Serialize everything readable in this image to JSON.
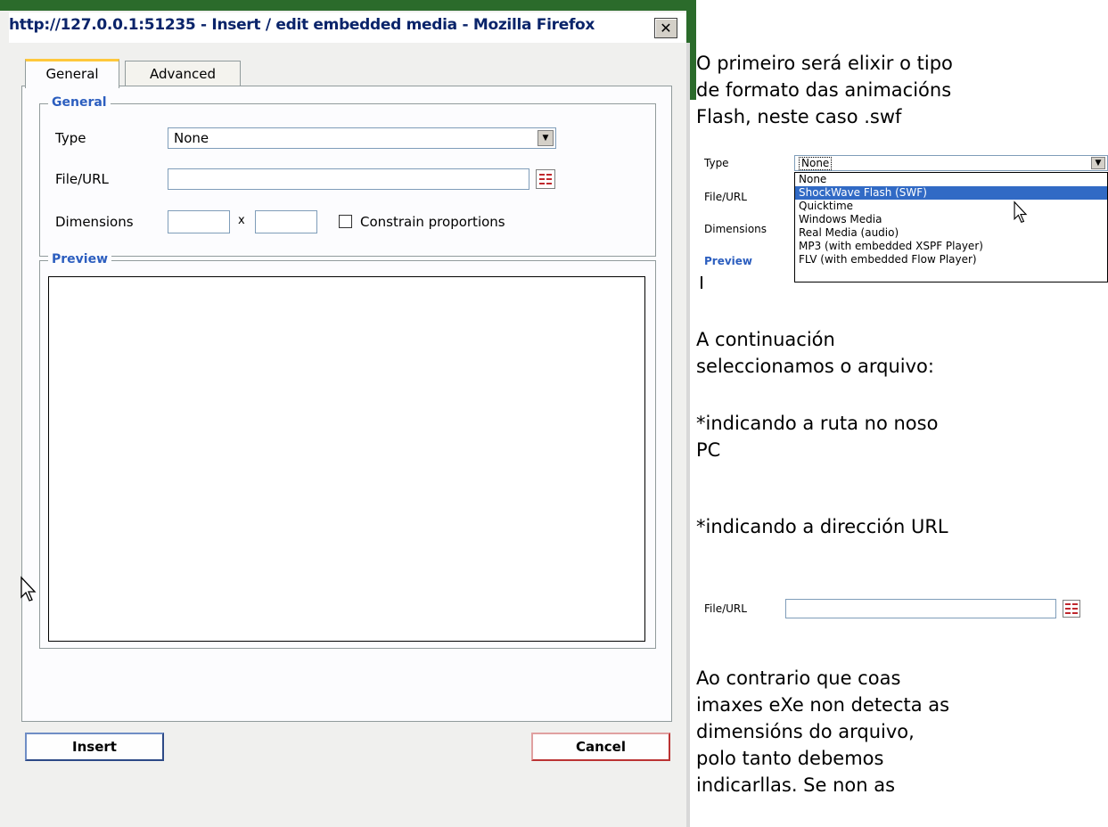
{
  "dialog": {
    "title": "http://127.0.0.1:51235 - Insert / edit embedded media - Mozilla Firefox",
    "close_label": "✕",
    "tabs": [
      {
        "label": "General",
        "active": true
      },
      {
        "label": "Advanced",
        "active": false
      }
    ],
    "general_legend": "General",
    "type_label": "Type",
    "type_value": "None",
    "file_label": "File/URL",
    "file_value": "",
    "dimensions_label": "Dimensions",
    "dimensions_sep": "x",
    "width_value": "",
    "height_value": "",
    "constrain_label": "Constrain proportions",
    "preview_legend": "Preview",
    "insert_label": "Insert",
    "cancel_label": "Cancel"
  },
  "instructions": {
    "p1": [
      "O primeiro será elixir o tipo",
      "de formato das animacións",
      "Flash, neste caso .swf"
    ],
    "p2": [
      "A continuación",
      "seleccionamos o arquivo:"
    ],
    "p3": [
      "*indicando a ruta no noso",
      "PC"
    ],
    "p4": "*indicando a dirección URL",
    "p5": [
      "Ao contrario que coas",
      "imaxes eXe non detecta as",
      "dimensións do arquivo,",
      "polo tanto debemos",
      "indicarllas. Se non as"
    ]
  },
  "dropdown_snapshot": {
    "type_label": "Type",
    "file_label": "File/URL",
    "dimensions_label": "Dimensions",
    "preview_label": "Preview",
    "selected": "None",
    "options": [
      "None",
      "ShockWave Flash (SWF)",
      "Quicktime",
      "Windows Media",
      "Real Media (audio)",
      "MP3 (with embedded XSPF Player)",
      "FLV (with embedded Flow Player)"
    ],
    "highlighted": "ShockWave Flash (SWF)"
  },
  "file_snapshot": {
    "label": "File/URL"
  },
  "colors": {
    "title": "#0a246a",
    "legend": "#2c5ebf",
    "highlight": "#316ac5",
    "active_tab_accent": "#ffc83c",
    "frame_green": "#2b6b2b"
  }
}
